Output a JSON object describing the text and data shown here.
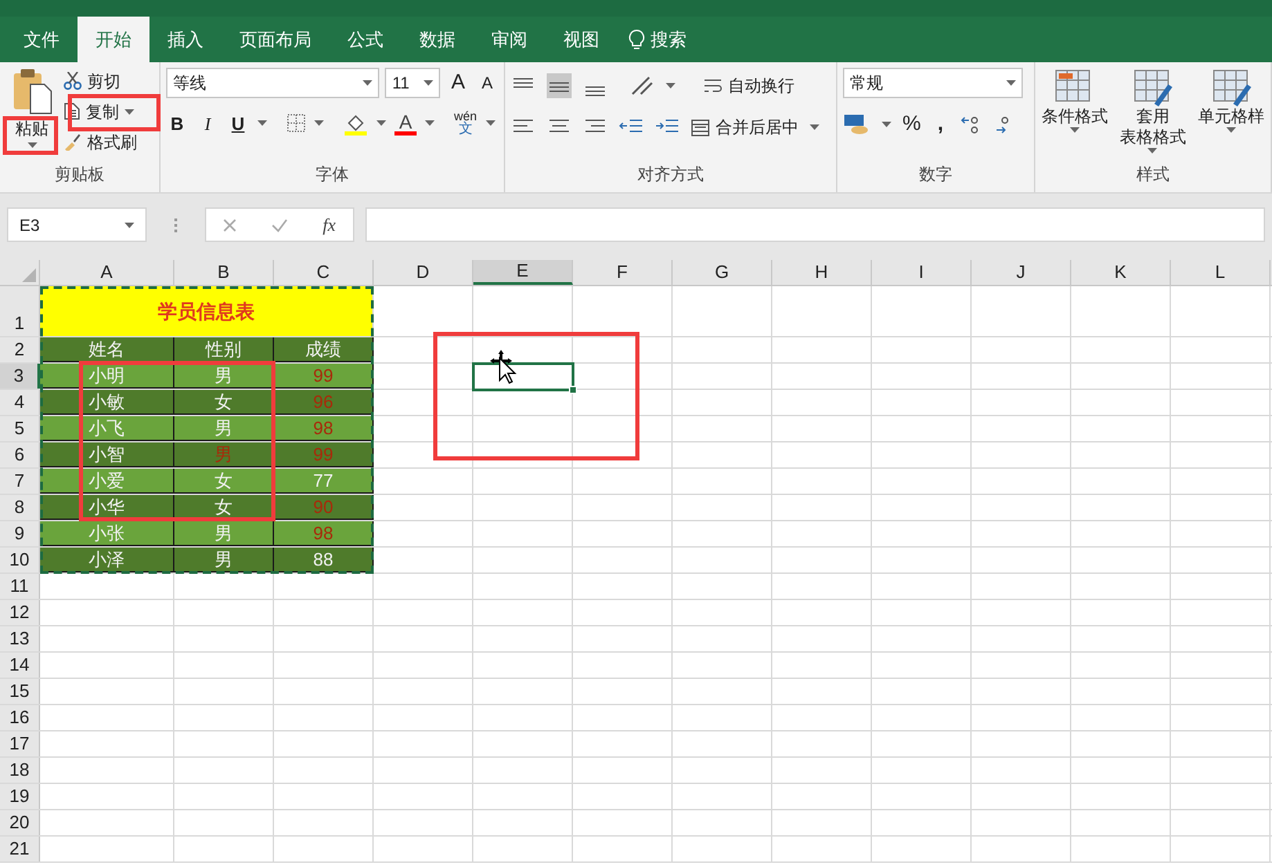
{
  "tabs": [
    {
      "label": "文件",
      "selected": false
    },
    {
      "label": "开始",
      "selected": true
    },
    {
      "label": "插入",
      "selected": false
    },
    {
      "label": "页面布局",
      "selected": false
    },
    {
      "label": "公式",
      "selected": false
    },
    {
      "label": "数据",
      "selected": false
    },
    {
      "label": "审阅",
      "selected": false
    },
    {
      "label": "视图",
      "selected": false
    }
  ],
  "search": {
    "label": "搜索"
  },
  "clipboard": {
    "paste": "粘贴",
    "cut": "剪切",
    "copy": "复制",
    "format_painter": "格式刷",
    "group": "剪贴板"
  },
  "font": {
    "name": "等线",
    "size": "11",
    "grow": "A",
    "shrink": "A",
    "styles": [
      {
        "kind": "bold",
        "label": "B"
      },
      {
        "kind": "italic",
        "label": "I"
      },
      {
        "kind": "underline",
        "label": "U"
      }
    ],
    "font_color": "A",
    "phonetic_top": "wén",
    "phonetic_bottom": "文",
    "group": "字体"
  },
  "alignment": {
    "wrap": "自动换行",
    "merge": "合并后居中",
    "group": "对齐方式"
  },
  "number": {
    "format": "常规",
    "percent": "%",
    "comma": ",",
    "group": "数字"
  },
  "styles": {
    "items": [
      {
        "lines": [
          "条件格式"
        ]
      },
      {
        "lines": [
          "套用",
          "表格格式"
        ]
      },
      {
        "lines": [
          "单元格样"
        ]
      }
    ],
    "group": "样式"
  },
  "formula_bar": {
    "name_box": "E3",
    "fx": "fx"
  },
  "sheet": {
    "columns": [
      {
        "label": "A",
        "selected": false
      },
      {
        "label": "B",
        "selected": false
      },
      {
        "label": "C",
        "selected": false
      },
      {
        "label": "D",
        "selected": false
      },
      {
        "label": "E",
        "selected": true
      },
      {
        "label": "F",
        "selected": false
      },
      {
        "label": "G",
        "selected": false
      },
      {
        "label": "H",
        "selected": false
      },
      {
        "label": "I",
        "selected": false
      },
      {
        "label": "J",
        "selected": false
      },
      {
        "label": "K",
        "selected": false
      },
      {
        "label": "L",
        "selected": false
      }
    ],
    "rows": [
      {
        "label": "1",
        "selected": false
      },
      {
        "label": "2",
        "selected": false
      },
      {
        "label": "3",
        "selected": true
      },
      {
        "label": "4",
        "selected": false
      },
      {
        "label": "5",
        "selected": false
      },
      {
        "label": "6",
        "selected": false
      },
      {
        "label": "7",
        "selected": false
      },
      {
        "label": "8",
        "selected": false
      },
      {
        "label": "9",
        "selected": false
      },
      {
        "label": "10",
        "selected": false
      },
      {
        "label": "11",
        "selected": false
      },
      {
        "label": "12",
        "selected": false
      },
      {
        "label": "13",
        "selected": false
      },
      {
        "label": "14",
        "selected": false
      },
      {
        "label": "15",
        "selected": false
      },
      {
        "label": "16",
        "selected": false
      },
      {
        "label": "17",
        "selected": false
      },
      {
        "label": "18",
        "selected": false
      },
      {
        "label": "19",
        "selected": false
      },
      {
        "label": "20",
        "selected": false
      },
      {
        "label": "21",
        "selected": false
      }
    ],
    "copy_marquee": true,
    "table": {
      "title": "学员信息表",
      "header": [
        "姓名",
        "性别",
        "成绩"
      ],
      "rows": [
        [
          {
            "text": "小明",
            "highlighted": false
          },
          {
            "text": "男",
            "highlighted": false
          },
          {
            "text": "99",
            "highlighted": true
          }
        ],
        [
          {
            "text": "小敏",
            "highlighted": false
          },
          {
            "text": "女",
            "highlighted": false
          },
          {
            "text": "96",
            "highlighted": true
          }
        ],
        [
          {
            "text": "小飞",
            "highlighted": false
          },
          {
            "text": "男",
            "highlighted": false
          },
          {
            "text": "98",
            "highlighted": true
          }
        ],
        [
          {
            "text": "小智",
            "highlighted": false
          },
          {
            "text": "男",
            "highlighted": true
          },
          {
            "text": "99",
            "highlighted": true
          }
        ],
        [
          {
            "text": "小爱",
            "highlighted": false
          },
          {
            "text": "女",
            "highlighted": false
          },
          {
            "text": "77",
            "highlighted": false
          }
        ],
        [
          {
            "text": "小华",
            "highlighted": false
          },
          {
            "text": "女",
            "highlighted": false
          },
          {
            "text": "90",
            "highlighted": true
          }
        ],
        [
          {
            "text": "小张",
            "highlighted": false
          },
          {
            "text": "男",
            "highlighted": false
          },
          {
            "text": "98",
            "highlighted": true
          }
        ],
        [
          {
            "text": "小泽",
            "highlighted": false
          },
          {
            "text": "男",
            "highlighted": false
          },
          {
            "text": "88",
            "highlighted": false
          }
        ]
      ]
    }
  }
}
